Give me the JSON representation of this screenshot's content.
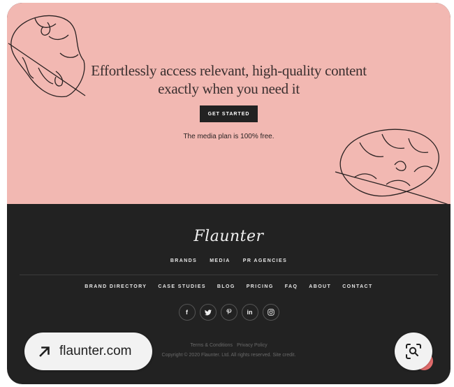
{
  "hero": {
    "headline_line1": "Effortlessly access relevant, high-quality content",
    "headline_line2": "exactly when you need it",
    "cta_label": "GET STARTED",
    "note": "The media plan is 100% free."
  },
  "footer": {
    "logo": "Flaunter",
    "primary_nav": [
      "BRANDS",
      "MEDIA",
      "PR AGENCIES"
    ],
    "secondary_nav": [
      "BRAND DIRECTORY",
      "CASE STUDIES",
      "BLOG",
      "PRICING",
      "FAQ",
      "ABOUT",
      "CONTACT"
    ],
    "social": [
      {
        "icon": "facebook-icon",
        "glyph": "f"
      },
      {
        "icon": "twitter-icon",
        "glyph": "🐦"
      },
      {
        "icon": "pinterest-icon",
        "glyph": "𝓅"
      },
      {
        "icon": "linkedin-icon",
        "glyph": "in"
      },
      {
        "icon": "instagram-icon",
        "glyph": "◎"
      }
    ],
    "legal": [
      "Terms & Conditions",
      "Privacy Policy"
    ],
    "copyright": "Copyright © 2020 Flaunter. Ltd. All rights reserved. Site credit."
  },
  "overlay": {
    "source_label": "flaunter.com"
  },
  "colors": {
    "hero_bg": "#f2b8b2",
    "footer_bg": "#222222",
    "accent": "#e26c6c"
  }
}
